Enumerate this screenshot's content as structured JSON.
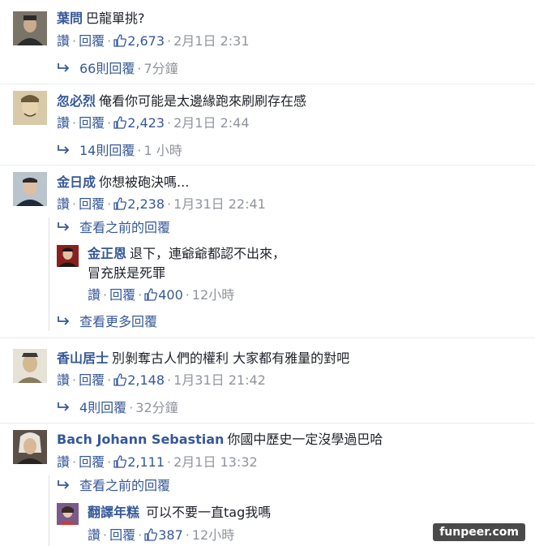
{
  "comments": [
    {
      "name": "葉問",
      "text": "巴龍單挑?",
      "like_label": "讚",
      "reply_label": "回覆",
      "likes": "2,673",
      "time": "2月1日 2:31",
      "replies_link": "66則回覆",
      "replies_ago": "7分鐘"
    },
    {
      "name": "忽必烈",
      "text": "俺看你可能是太邊緣跑來刷刷存在感",
      "like_label": "讚",
      "reply_label": "回覆",
      "likes": "2,423",
      "time": "2月1日 2:44",
      "replies_link": "14則回覆",
      "replies_ago": "1 小時"
    },
    {
      "name": "金日成",
      "text": "你想被砲決嗎...",
      "like_label": "讚",
      "reply_label": "回覆",
      "likes": "2,238",
      "time": "1月31日 22:41",
      "view_prev": "查看之前的回覆",
      "reply": {
        "name": "金正恩",
        "text1": "退下，連爺爺都認不出來，",
        "text2": "冒充朕是死罪",
        "like_label": "讚",
        "reply_label": "回覆",
        "likes": "400",
        "time": "12小時"
      },
      "view_more": "查看更多回覆"
    },
    {
      "name": "香山居士",
      "text": "別剝奪古人們的權利 大家都有雅量的對吧",
      "like_label": "讚",
      "reply_label": "回覆",
      "likes": "2,148",
      "time": "1月31日 21:42",
      "replies_link": "4則回覆",
      "replies_ago": "32分鐘"
    },
    {
      "name": "Bach Johann Sebastian",
      "text": "你國中歷史一定沒學過巴哈",
      "like_label": "讚",
      "reply_label": "回覆",
      "likes": "2,111",
      "time": "2月1日 13:32",
      "view_prev": "查看之前的回覆",
      "reply": {
        "name": "翻譯年糕",
        "text1": "可以不要一直tag我嗎",
        "like_label": "讚",
        "reply_label": "回覆",
        "likes": "387",
        "time": "12小時"
      }
    }
  ],
  "watermark": "funpeer.com",
  "colors": {
    "link": "#365899",
    "muted": "#90949c",
    "text": "#1d2129"
  }
}
